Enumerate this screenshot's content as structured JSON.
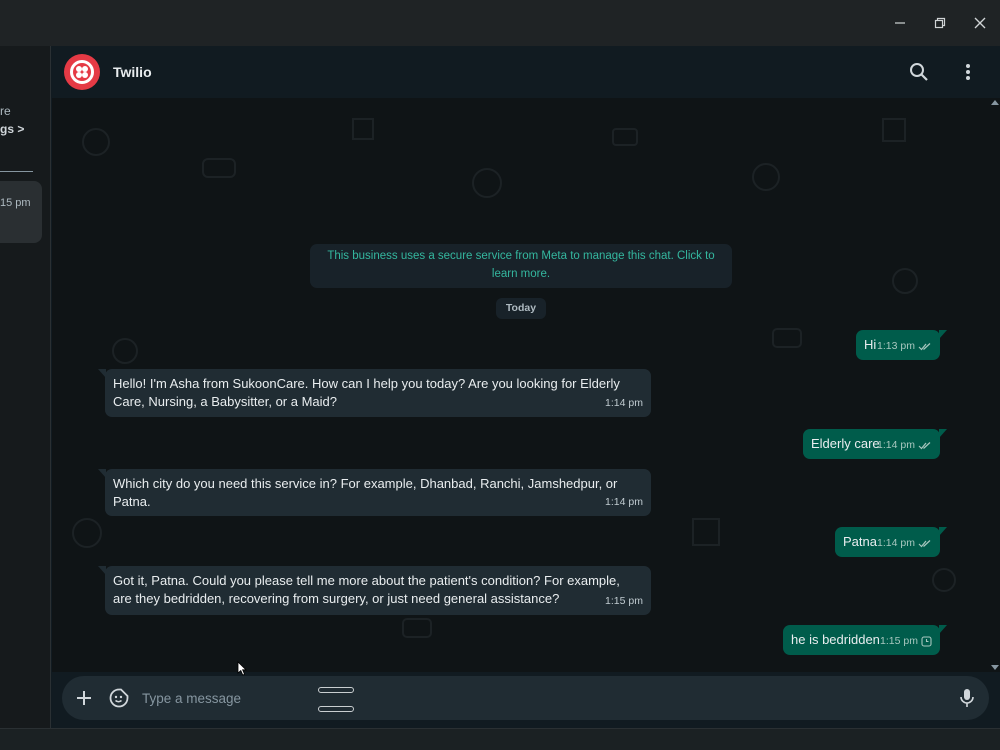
{
  "window": {
    "minimize_icon": "minimize-icon",
    "restore_icon": "restore-icon",
    "close_icon": "close-icon"
  },
  "sidebar": {
    "fragment_1": "re",
    "fragment_2": "gs >",
    "chat_time": "15 pm"
  },
  "header": {
    "contact_name": "Twilio",
    "avatar": "twilio-logo",
    "search_icon": "search-icon",
    "menu_icon": "more-vertical-icon"
  },
  "chat": {
    "system_message": "This business uses a secure service from Meta to manage this chat. Click to learn more.",
    "date_label": "Today",
    "messages": [
      {
        "direction": "out",
        "text": "Hi",
        "time": "1:13 pm",
        "status": "read"
      },
      {
        "direction": "in",
        "text": "Hello! I'm Asha from SukoonCare. How can I help you today? Are you looking for Elderly Care, Nursing, a Babysitter, or a Maid?",
        "time": "1:14 pm"
      },
      {
        "direction": "out",
        "text": "Elderly care",
        "time": "1:14 pm",
        "status": "read"
      },
      {
        "direction": "in",
        "text": "Which city do you need this service in? For example, Dhanbad, Ranchi, Jamshedpur, or Patna.",
        "time": "1:14 pm"
      },
      {
        "direction": "out",
        "text": "Patna",
        "time": "1:14 pm",
        "status": "read"
      },
      {
        "direction": "in",
        "text": "Got it, Patna. Could you please tell me more about the patient's condition? For example, are they bedridden, recovering from surgery, or just need general assistance?",
        "time": "1:15 pm"
      },
      {
        "direction": "out",
        "text": "he is bedridden",
        "time": "1:15 pm",
        "status": "pending"
      }
    ]
  },
  "composer": {
    "placeholder": "Type a message",
    "attach_icon": "plus-icon",
    "sticker_icon": "sticker-icon",
    "mic_icon": "microphone-icon"
  },
  "colors": {
    "background": "#111b21",
    "outgoing_bubble": "#005c4b",
    "incoming_bubble": "#202c33",
    "system_text": "#34b79f",
    "brand_red": "#e53a45"
  }
}
